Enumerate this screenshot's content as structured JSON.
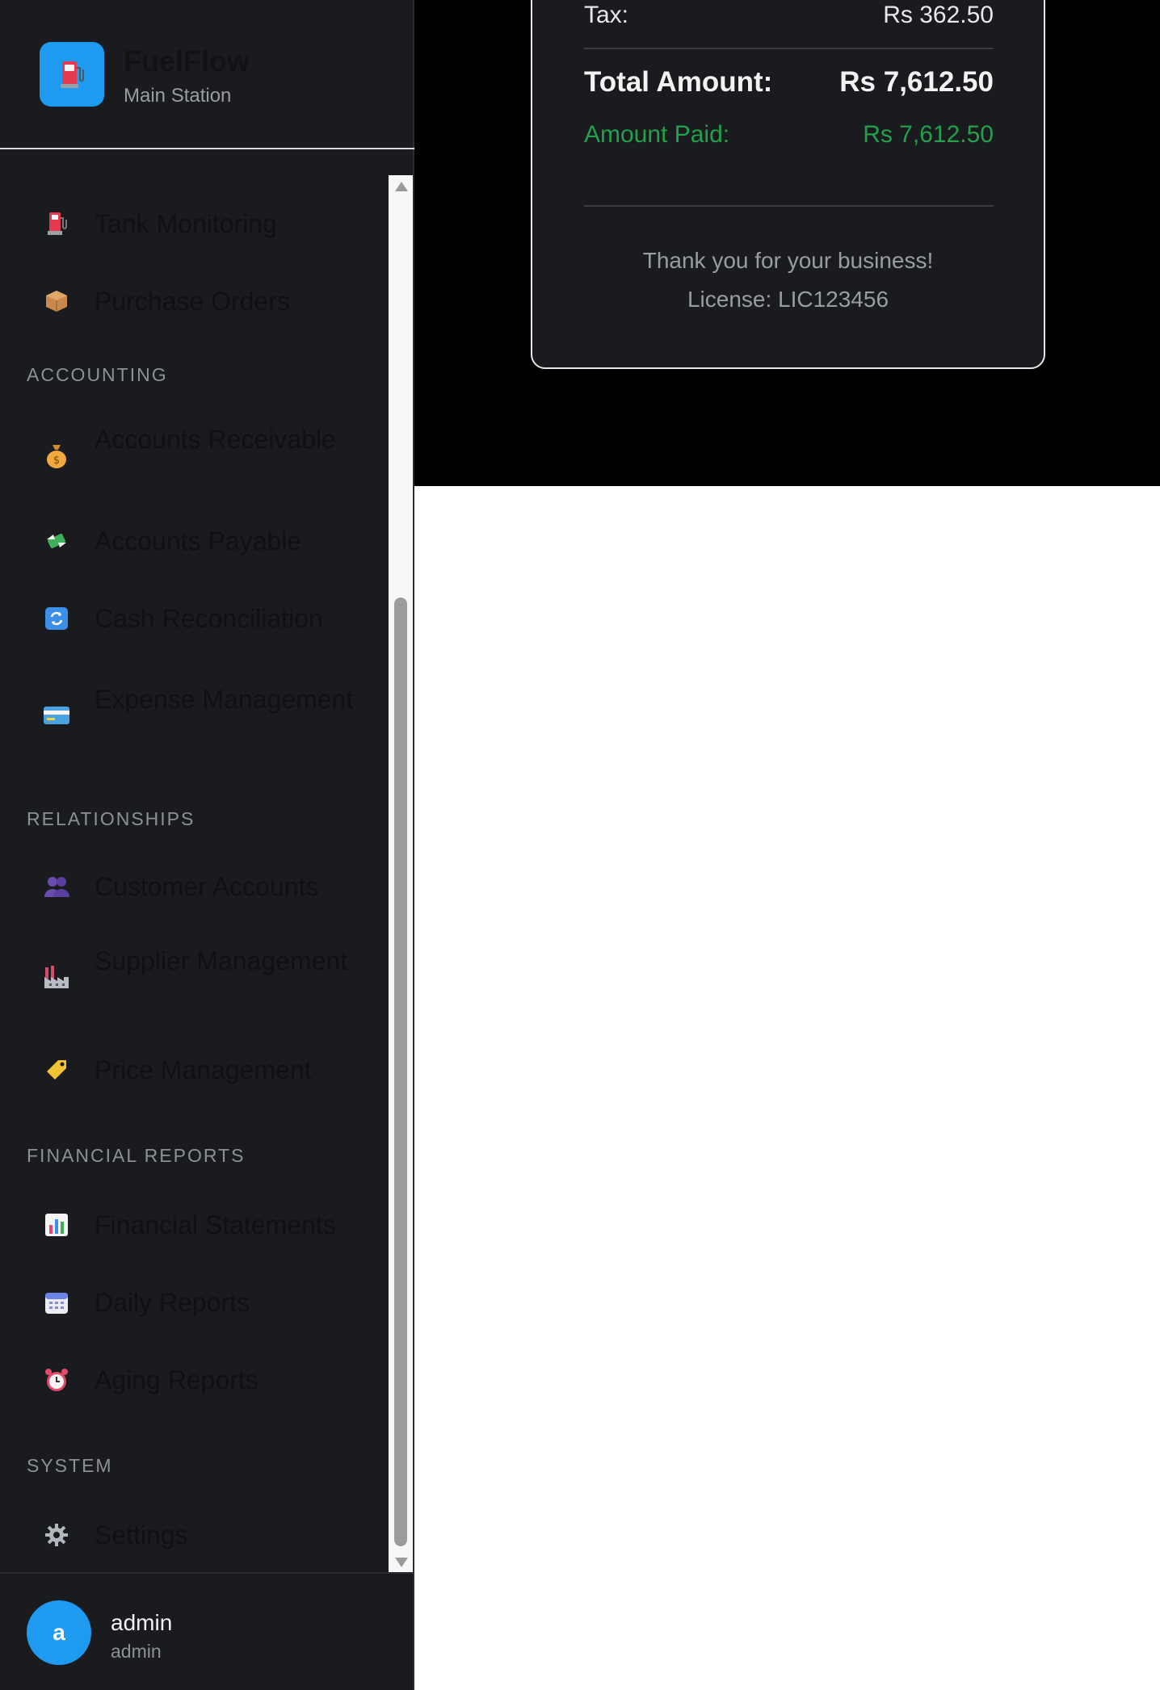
{
  "brand": {
    "name": "FuelFlow",
    "station": "Main Station",
    "logo_icon": "fuel-pump-icon"
  },
  "sidebar": {
    "items": [
      {
        "label": "Tank Monitoring",
        "icon": "fuel-pump-icon"
      },
      {
        "label": "Purchase Orders",
        "icon": "package-icon"
      },
      {
        "label": "Accounts Receivable",
        "icon": "money-bag-icon"
      },
      {
        "label": "Accounts Payable",
        "icon": "money-wings-icon"
      },
      {
        "label": "Cash Reconciliation",
        "icon": "refresh-icon"
      },
      {
        "label": "Expense Management",
        "icon": "credit-card-icon"
      },
      {
        "label": "Customer Accounts",
        "icon": "people-icon"
      },
      {
        "label": "Supplier Management",
        "icon": "factory-icon"
      },
      {
        "label": "Price Management",
        "icon": "price-tag-icon"
      },
      {
        "label": "Financial Statements",
        "icon": "bar-chart-icon"
      },
      {
        "label": "Daily Reports",
        "icon": "calendar-icon"
      },
      {
        "label": "Aging Reports",
        "icon": "alarm-clock-icon"
      },
      {
        "label": "Settings",
        "icon": "gear-icon"
      }
    ],
    "sections": {
      "accounting": "ACCOUNTING",
      "relationships": "RELATIONSHIPS",
      "financial_reports": "FINANCIAL REPORTS",
      "system": "SYSTEM"
    }
  },
  "user": {
    "initial": "a",
    "name": "admin",
    "role": "admin"
  },
  "receipt": {
    "tax_label": "Tax:",
    "tax_value": "Rs 362.50",
    "total_label": "Total Amount:",
    "total_value": "Rs 7,612.50",
    "paid_label": "Amount Paid:",
    "paid_value": "Rs 7,612.50",
    "thanks": "Thank you for your business!",
    "license": "License: LIC123456"
  },
  "colors": {
    "accent": "#1e9bf0",
    "paid": "#22a04b",
    "sidebar_bg": "#1a1b1f"
  }
}
